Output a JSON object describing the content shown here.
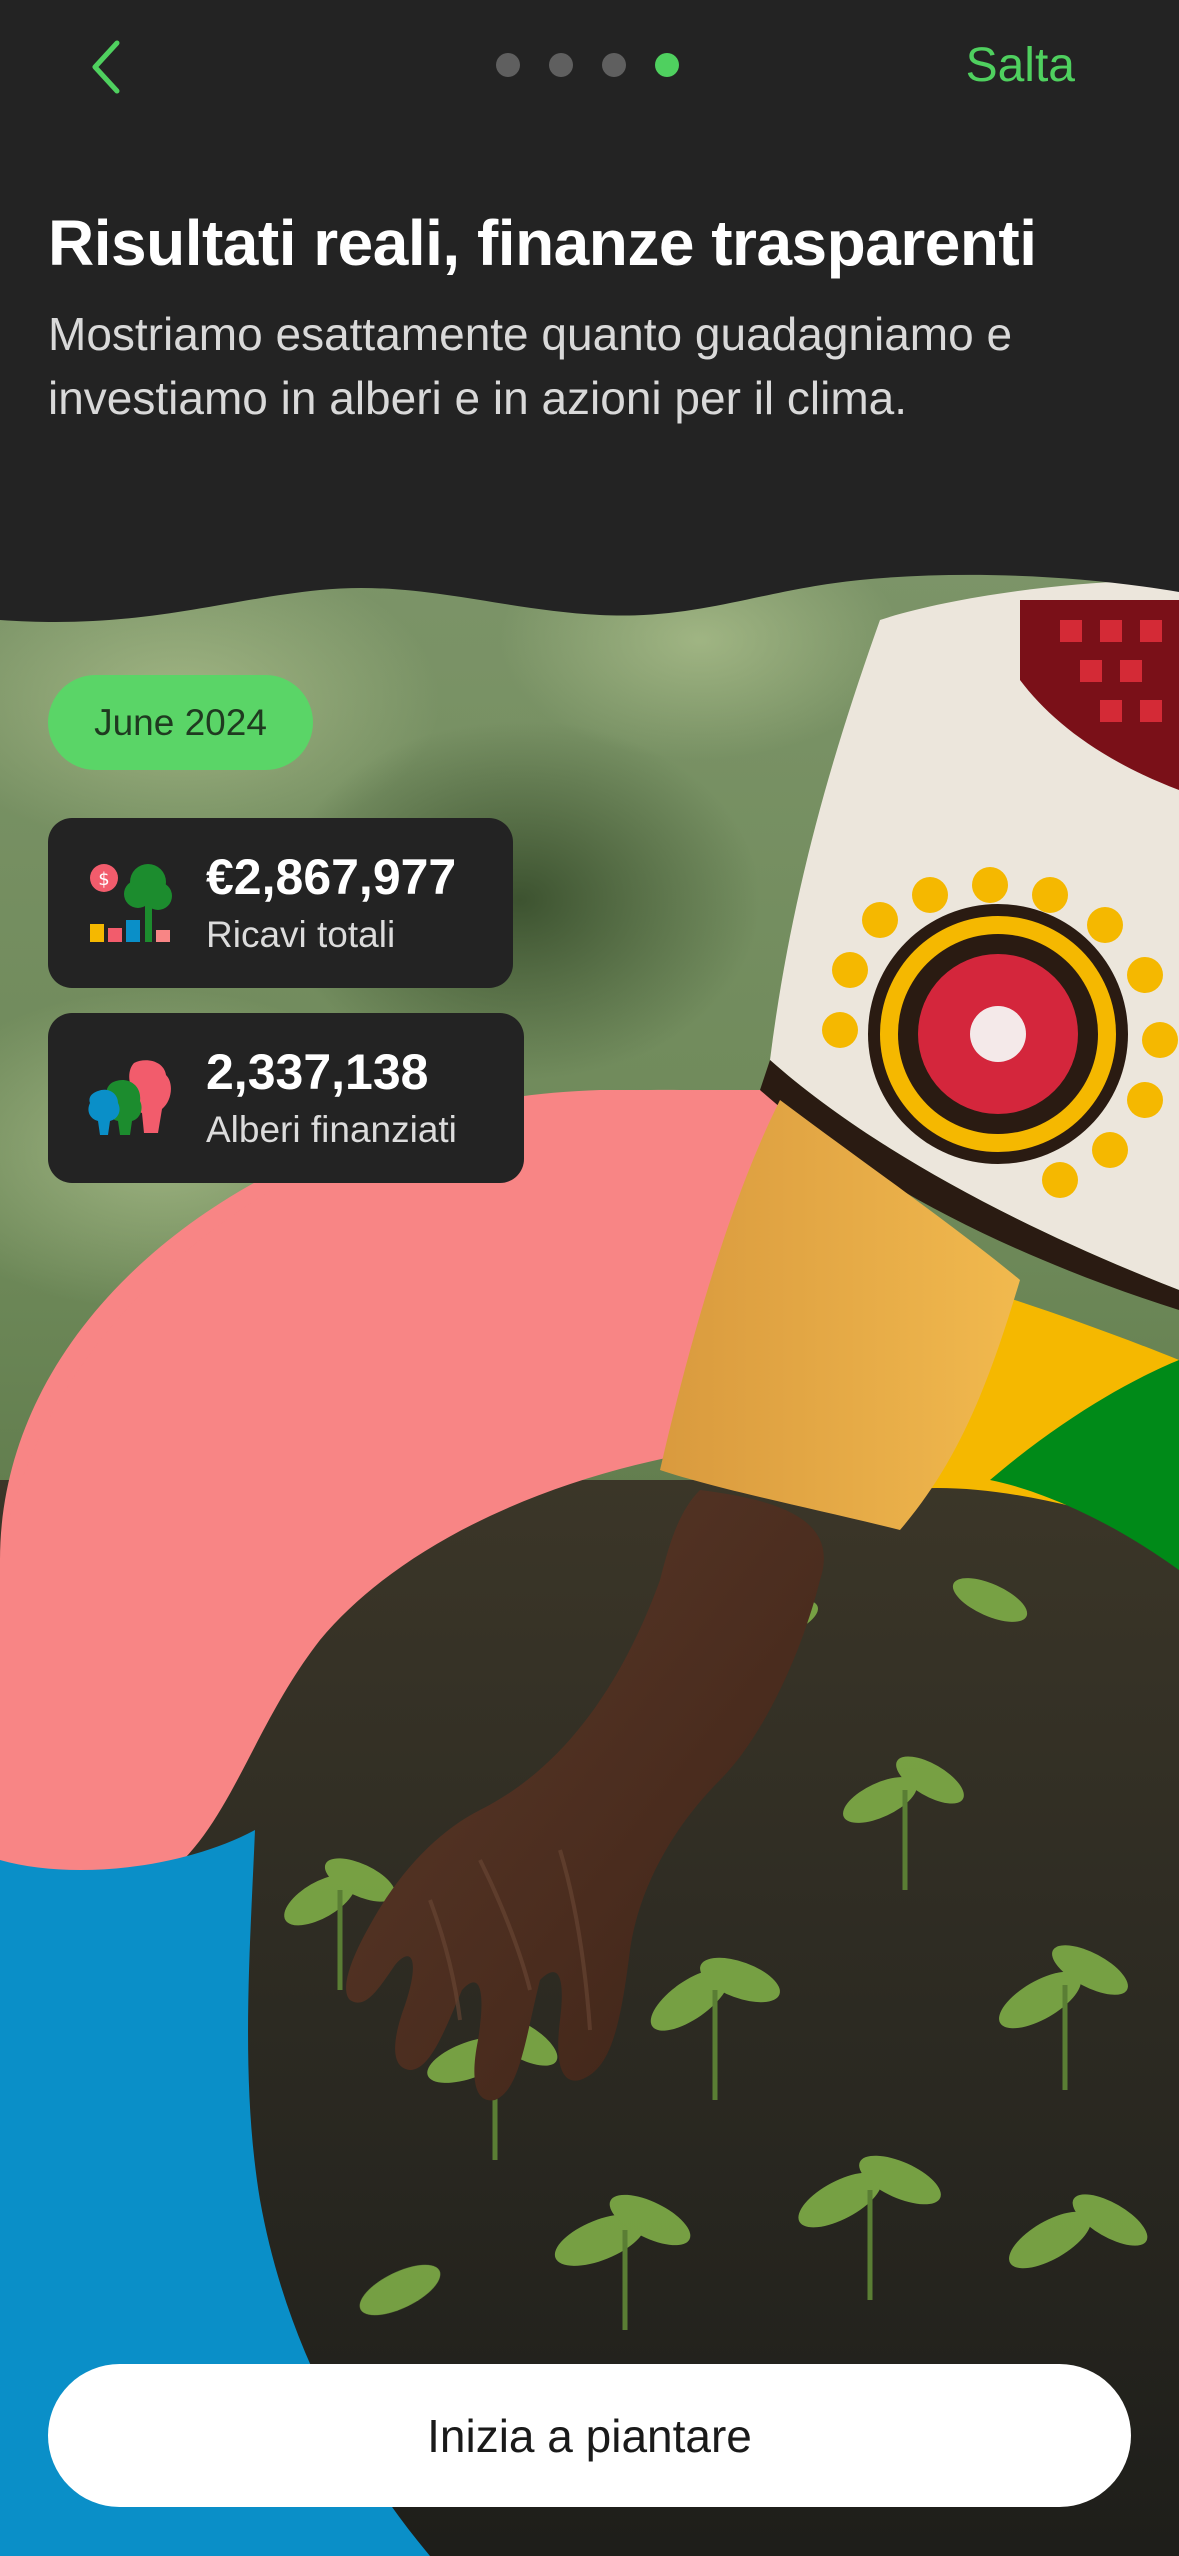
{
  "header": {
    "skip_label": "Salta",
    "page_count": 4,
    "active_page": 4
  },
  "intro": {
    "title": "Risultati reali, finanze trasparenti",
    "subtitle": "Mostriamo esattamente quanto guadagniamo e investiamo in alberi e in azioni per il clima."
  },
  "stats": {
    "period": "June 2024",
    "revenue": {
      "value": "€2,867,977",
      "label": "Ricavi totali",
      "icon": "revenue-chart-icon"
    },
    "trees": {
      "value": "2,337,138",
      "label": "Alberi finanziati",
      "icon": "trees-icon"
    }
  },
  "cta": {
    "label": "Inizia a piantare"
  },
  "colors": {
    "accent_green": "#4fd05f",
    "pill_green": "#5ad567",
    "background": "#232323",
    "coral": "#f88585",
    "blue": "#0a8fc8",
    "yellow": "#f5b800",
    "forest_green": "#008a18"
  }
}
